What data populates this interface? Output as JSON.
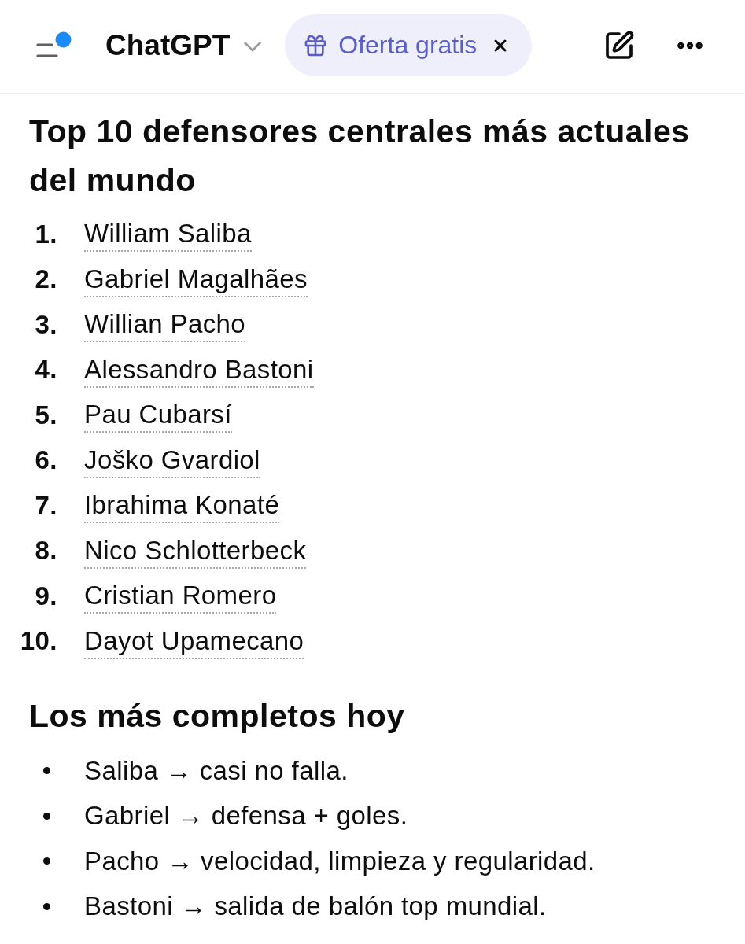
{
  "header": {
    "model_name": "ChatGPT",
    "offer": {
      "label": "Oferta gratis"
    }
  },
  "sections": [
    {
      "kind": "ordered",
      "heading": "Top 10 defensores centrales más actuales del mundo",
      "items": [
        {
          "number": "1.",
          "text": "William Saliba"
        },
        {
          "number": "2.",
          "text": "Gabriel Magalhães"
        },
        {
          "number": "3.",
          "text": "Willian Pacho"
        },
        {
          "number": "4.",
          "text": "Alessandro Bastoni"
        },
        {
          "number": "5.",
          "text": "Pau Cubarsí"
        },
        {
          "number": "6.",
          "text": "Joško Gvardiol"
        },
        {
          "number": "7.",
          "text": "Ibrahima Konaté"
        },
        {
          "number": "8.",
          "text": "Nico Schlotterbeck"
        },
        {
          "number": "9.",
          "text": "Cristian Romero"
        },
        {
          "number": "10.",
          "text": "Dayot Upamecano"
        }
      ]
    },
    {
      "kind": "bulleted",
      "heading": "Los más completos hoy",
      "items": [
        {
          "text": "Saliba → casi no falla."
        },
        {
          "text": "Gabriel → defensa + goles."
        },
        {
          "text": "Pacho → velocidad, limpieza y regularidad."
        },
        {
          "text": "Bastoni → salida de balón top mundial."
        }
      ]
    }
  ]
}
